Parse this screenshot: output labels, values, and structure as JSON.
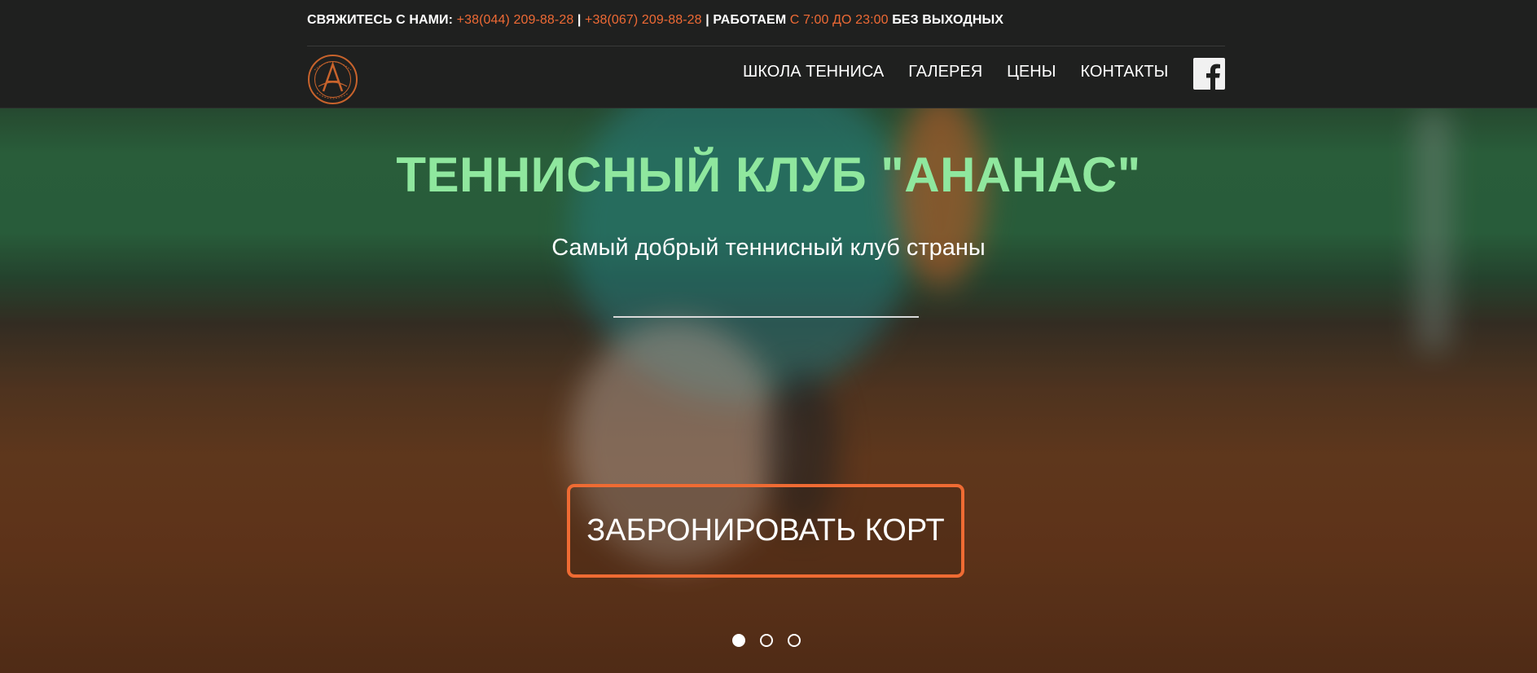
{
  "topbar": {
    "contact_label": "СВЯЖИТЕСЬ С НАМИ:",
    "phone_1": "+38(044) 209-88-28",
    "separator_1": "|",
    "phone_2": "+38(067) 209-88-28",
    "working_label": "| РАБОТАЕМ",
    "hours": "С 7:00 ДО 23:00",
    "days": "БЕЗ ВЫХОДНЫХ"
  },
  "logo": {
    "top_text": "ТЕННИСНЫЙ КЛУБ",
    "letter": "A",
    "bottom_text": "АНАНАС"
  },
  "nav": {
    "items": [
      {
        "label": "ШКОЛА ТЕННИСА"
      },
      {
        "label": "ГАЛЕРЕЯ"
      },
      {
        "label": "ЦЕНЫ"
      },
      {
        "label": "КОНТАКТЫ"
      }
    ],
    "social_icon": "facebook-icon"
  },
  "hero": {
    "title": "ТЕННИСНЫЙ КЛУБ \"АНАНАС\"",
    "subtitle": "Самый добрый теннисный клуб страны",
    "cta_label": "ЗАБРОНИРОВАТЬ КОРТ",
    "slides_count": 3,
    "active_slide": 1
  },
  "colors": {
    "accent": "#ee6a35",
    "title_green": "#8fe79e",
    "bar_bg": "#1f201f"
  }
}
